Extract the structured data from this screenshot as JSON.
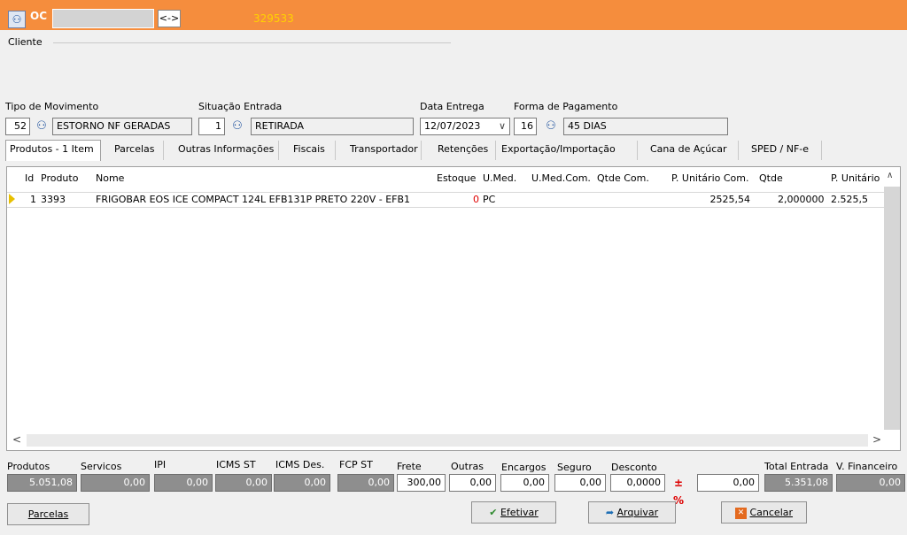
{
  "header": {
    "title": "OC",
    "code": "329533",
    "nav_label": "<->"
  },
  "cliente": {
    "label": "Cliente"
  },
  "movimento": {
    "tipo_label": "Tipo  de Movimento",
    "tipo_code": "52",
    "tipo_desc": "ESTORNO NF GERADAS",
    "situacao_label": "Situação Entrada",
    "situacao_code": "1",
    "situacao_desc": "RETIRADA",
    "data_label": "Data Entrega",
    "data_value": "12/07/2023",
    "pagamento_label": "Forma de Pagamento",
    "pagamento_code": "16",
    "pagamento_desc": "45 DIAS"
  },
  "tabs": [
    "Produtos - 1 Item",
    "Parcelas",
    "Outras Informações",
    "Fiscais",
    "Transportador",
    "Retenções",
    "Exportação/Importação",
    "Cana de Açúcar",
    "SPED / NF-e"
  ],
  "table": {
    "headers": [
      "Id",
      "Produto",
      "Nome",
      "Estoque",
      "U.Med.",
      "U.Med.Com.",
      "Qtde Com.",
      "P. Unitário Com.",
      "Qtde",
      "P. Unitário"
    ],
    "row": {
      "id": "1",
      "produto": "3393",
      "nome": "FRIGOBAR EOS ICE COMPACT 124L EFB131P PRETO 220V - EFB1",
      "estoque": "0",
      "umed": "PC",
      "umedcom": "",
      "qtdecom": "",
      "punitcom": "2525,54",
      "qtde": "2,000000",
      "punit": "2.525,5"
    }
  },
  "totals": {
    "produtos_label": "Produtos",
    "produtos": "5.051,08",
    "servicos_label": "Servicos",
    "servicos": "0,00",
    "ipi_label": "IPI",
    "ipi": "0,00",
    "icmsst_label": "ICMS ST",
    "icmsst": "0,00",
    "icmsdes_label": "ICMS Des.",
    "icmsdes": "0,00",
    "fcpst_label": "FCP ST",
    "fcpst": "0,00",
    "frete_label": "Frete",
    "frete": "300,00",
    "outras_label": "Outras",
    "outras": "0,00",
    "encargos_label": "Encargos",
    "encargos": "0,00",
    "seguro_label": "Seguro",
    "seguro": "0,00",
    "desconto_label": "Desconto",
    "desconto": "0,0000",
    "desconto_valor": "0,00",
    "total_label": "Total Entrada",
    "total": "5.351,08",
    "financeiro_label": "V. Financeiro",
    "financeiro": "0,00"
  },
  "buttons": {
    "parcelas": "Parcelas",
    "efetivar": "Efetivar",
    "arquivar": "Arquivar",
    "cancelar": "Cancelar"
  },
  "colors": {
    "header": "#f58d3d",
    "code": "#ffd200",
    "binoculars": "#1b4f9c",
    "estoque_zero": "#e00000"
  }
}
